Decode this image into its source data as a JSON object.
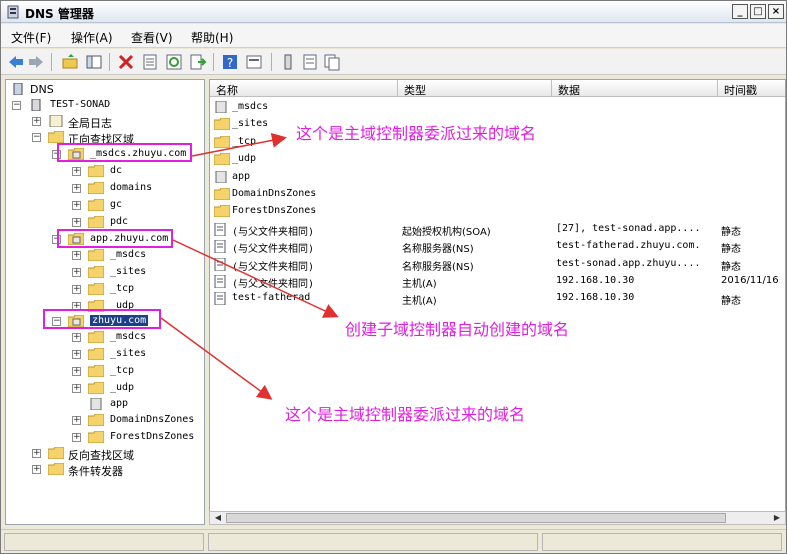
{
  "window": {
    "title": "DNS 管理器",
    "minimize": "_",
    "maximize": "□",
    "close": "×"
  },
  "menu": [
    {
      "label": "文件(F)"
    },
    {
      "label": "操作(A)"
    },
    {
      "label": "查看(V)"
    },
    {
      "label": "帮助(H)"
    }
  ],
  "toolbar": [
    "back-icon",
    "forward-icon",
    "up-icon",
    "show-hide-tree-icon",
    "delete-icon",
    "properties-icon",
    "refresh-icon",
    "export-icon",
    "help-icon",
    "view-icon",
    "server-icon",
    "list-icon",
    "copy-icon"
  ],
  "tree": {
    "root": "DNS",
    "server": "TEST-SONAD",
    "global_logs": "全局日志",
    "forward_zone": "正向查找区域",
    "zone1": {
      "name": "_msdcs.zhuyu.com",
      "children": [
        "dc",
        "domains",
        "gc",
        "pdc"
      ]
    },
    "zone2": {
      "name": "app.zhuyu.com",
      "children": [
        "_msdcs",
        "_sites",
        "_tcp",
        "_udp"
      ]
    },
    "zone3": {
      "name": "zhuyu.com",
      "children": [
        "_msdcs",
        "_sites",
        "_tcp",
        "_udp",
        "app",
        "DomainDnsZones",
        "ForestDnsZones"
      ]
    },
    "reverse_zone": "反向查找区域",
    "forwarders": "条件转发器"
  },
  "columns": [
    "名称",
    "类型",
    "数据",
    "时间戳"
  ],
  "records": [
    {
      "name": "_msdcs",
      "type": "",
      "data": "",
      "ts": "",
      "icon": "zone"
    },
    {
      "name": "_sites",
      "type": "",
      "data": "",
      "ts": "",
      "icon": "folder"
    },
    {
      "name": "_tcp",
      "type": "",
      "data": "",
      "ts": "",
      "icon": "folder"
    },
    {
      "name": "_udp",
      "type": "",
      "data": "",
      "ts": "",
      "icon": "folder"
    },
    {
      "name": "app",
      "type": "",
      "data": "",
      "ts": "",
      "icon": "zone"
    },
    {
      "name": "DomainDnsZones",
      "type": "",
      "data": "",
      "ts": "",
      "icon": "folder"
    },
    {
      "name": "ForestDnsZones",
      "type": "",
      "data": "",
      "ts": "",
      "icon": "folder"
    },
    {
      "name": "(与父文件夹相同)",
      "type": "起始授权机构(SOA)",
      "data": "[27], test-sonad.app....",
      "ts": "静态",
      "icon": "record"
    },
    {
      "name": "(与父文件夹相同)",
      "type": "名称服务器(NS)",
      "data": "test-fatherad.zhuyu.com.",
      "ts": "静态",
      "icon": "record"
    },
    {
      "name": "(与父文件夹相同)",
      "type": "名称服务器(NS)",
      "data": "test-sonad.app.zhuyu....",
      "ts": "静态",
      "icon": "record"
    },
    {
      "name": "(与父文件夹相同)",
      "type": "主机(A)",
      "data": "192.168.10.30",
      "ts": "2016/11/16",
      "icon": "record"
    },
    {
      "name": "test-fatherad",
      "type": "主机(A)",
      "data": "192.168.10.30",
      "ts": "静态",
      "icon": "record"
    }
  ],
  "annotations": {
    "a1": "这个是主域控制器委派过来的域名",
    "a2": "创建子域控制器自动创建的域名",
    "a3": "这个是主域控制器委派过来的域名"
  },
  "colors": {
    "annotation": "#e020e0",
    "arrow": "#e03030"
  }
}
